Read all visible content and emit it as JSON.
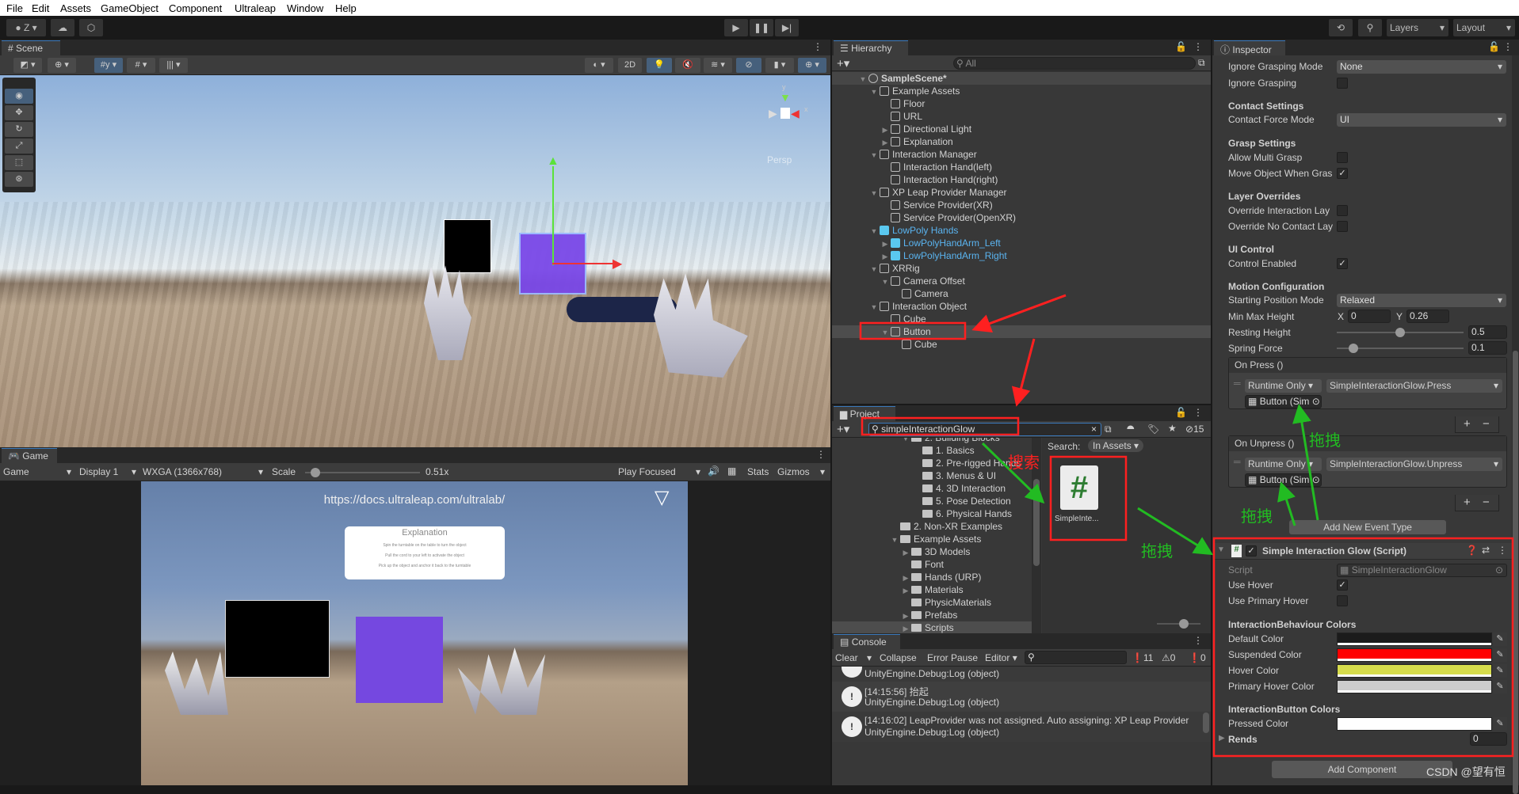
{
  "menu": [
    "File",
    "Edit",
    "Assets",
    "GameObject",
    "Component",
    "Ultraleap",
    "Window",
    "Help"
  ],
  "toolbar": {
    "account": "Z",
    "layers": "Layers",
    "layout": "Layout"
  },
  "colors": {
    "accent": "#3a79bb",
    "selection": "#4d4d4d",
    "prefab": "#5ac8ef",
    "annotation_red": "#ff2020",
    "annotation_green": "#22bb22",
    "suspended": "#ff0000",
    "hover": "#d6dc4c",
    "primary_hover": "#cccccc",
    "default": "#1b1b1b",
    "pressed": "#ffffff"
  },
  "scene": {
    "tab": "Scene",
    "two_d": "2D",
    "persp": "Persp",
    "gizmo_y": "y",
    "gizmo_x": "x"
  },
  "game": {
    "tab": "Game",
    "mode": "Game",
    "display": "Display 1",
    "resolution": "WXGA (1366x768)",
    "scale_label": "Scale",
    "scale_value": "0.51x",
    "scale_fraction": 0.05,
    "play_mode": "Play Focused",
    "stats": "Stats",
    "gizmos": "Gizmos",
    "url": "https://docs.ultraleap.com/ultralab/",
    "explanation": {
      "title": "Explanation",
      "lines": [
        "Spin the turntable on the table to turn the object",
        "Pull the cord to your left to activate the object",
        "Pick up the object and anchor it back to the turntable"
      ]
    }
  },
  "hierarchy": {
    "tab": "Hierarchy",
    "search_placeholder": "All",
    "items": [
      {
        "label": "SampleScene*",
        "level": 0,
        "expand": "open",
        "icon": "unity-scene",
        "scene": true
      },
      {
        "label": "Example Assets",
        "level": 1,
        "expand": "open",
        "icon": "cube"
      },
      {
        "label": "Floor",
        "level": 2,
        "expand": "",
        "icon": "cube"
      },
      {
        "label": "URL",
        "level": 2,
        "expand": "",
        "icon": "cube"
      },
      {
        "label": "Directional Light",
        "level": 2,
        "expand": "closed",
        "icon": "cube"
      },
      {
        "label": "Explanation",
        "level": 2,
        "expand": "closed",
        "icon": "cube"
      },
      {
        "label": "Interaction Manager",
        "level": 1,
        "expand": "open",
        "icon": "cube"
      },
      {
        "label": "Interaction Hand(left)",
        "level": 2,
        "expand": "",
        "icon": "cube"
      },
      {
        "label": "Interaction Hand(right)",
        "level": 2,
        "expand": "",
        "icon": "cube"
      },
      {
        "label": "XP Leap Provider Manager",
        "level": 1,
        "expand": "open",
        "icon": "cube"
      },
      {
        "label": "Service Provider(XR)",
        "level": 2,
        "expand": "",
        "icon": "cube"
      },
      {
        "label": "Service Provider(OpenXR)",
        "level": 2,
        "expand": "",
        "icon": "cube"
      },
      {
        "label": "LowPoly Hands",
        "level": 1,
        "expand": "open",
        "icon": "prefab",
        "prefab": true
      },
      {
        "label": "LowPolyHandArm_Left",
        "level": 2,
        "expand": "closed",
        "icon": "prefab",
        "prefab": true
      },
      {
        "label": "LowPolyHandArm_Right",
        "level": 2,
        "expand": "closed",
        "icon": "prefab",
        "prefab": true
      },
      {
        "label": "XRRig",
        "level": 1,
        "expand": "open",
        "icon": "cube"
      },
      {
        "label": "Camera Offset",
        "level": 2,
        "expand": "open",
        "icon": "cube"
      },
      {
        "label": "Camera",
        "level": 3,
        "expand": "",
        "icon": "cube"
      },
      {
        "label": "Interaction Object",
        "level": 1,
        "expand": "open",
        "icon": "cube"
      },
      {
        "label": "Cube",
        "level": 2,
        "expand": "",
        "icon": "cube"
      },
      {
        "label": "Button",
        "level": 2,
        "expand": "open",
        "icon": "cube",
        "selected": true
      },
      {
        "label": "Cube",
        "level": 3,
        "expand": "",
        "icon": "cube"
      }
    ]
  },
  "project": {
    "tab": "Project",
    "search_value": "simpleInteractionGlow",
    "hidden_count": "15",
    "search_label": "Search:",
    "search_scope": "In Assets",
    "tree": [
      {
        "label": "2. Building Blocks",
        "level": 1,
        "expand": "open"
      },
      {
        "label": "1. Basics",
        "level": 2,
        "expand": ""
      },
      {
        "label": "2. Pre-rigged Hands",
        "level": 2,
        "expand": ""
      },
      {
        "label": "3. Menus & UI",
        "level": 2,
        "expand": ""
      },
      {
        "label": "4. 3D Interaction",
        "level": 2,
        "expand": ""
      },
      {
        "label": "5. Pose Detection",
        "level": 2,
        "expand": ""
      },
      {
        "label": "6. Physical Hands",
        "level": 2,
        "expand": ""
      },
      {
        "label": "2. Non-XR Examples",
        "level": 0,
        "expand": ""
      },
      {
        "label": "Example Assets",
        "level": 0,
        "expand": "open"
      },
      {
        "label": "3D Models",
        "level": 1,
        "expand": "closed"
      },
      {
        "label": "Font",
        "level": 1,
        "expand": ""
      },
      {
        "label": "Hands (URP)",
        "level": 1,
        "expand": "closed"
      },
      {
        "label": "Materials",
        "level": 1,
        "expand": "closed"
      },
      {
        "label": "PhysicMaterials",
        "level": 1,
        "expand": ""
      },
      {
        "label": "Prefabs",
        "level": 1,
        "expand": "closed"
      },
      {
        "label": "Scripts",
        "level": 1,
        "expand": "closed",
        "selected": true
      }
    ],
    "asset": {
      "name": "SimpleInte...",
      "icon": "csharp-script"
    }
  },
  "console": {
    "tab": "Console",
    "clear": "Clear",
    "collapse": "Collapse",
    "error_pause": "Error Pause",
    "editor": "Editor",
    "log_count": "11",
    "warn_count": "0",
    "error_count": "0",
    "entries": [
      {
        "line1": "",
        "line2": "UnityEngine.Debug:Log (object)"
      },
      {
        "line1": "[14:15:56] 抬起",
        "line2": "UnityEngine.Debug:Log (object)"
      },
      {
        "line1": "[14:16:02] LeapProvider was not assigned. Auto assigning: XP Leap Provider",
        "line2": "UnityEngine.Debug:Log (object)"
      }
    ]
  },
  "inspector": {
    "tab": "Inspector",
    "ignore_grasping_mode": {
      "label": "Ignore Grasping Mode",
      "value": "None"
    },
    "ignore_grasping": {
      "label": "Ignore Grasping",
      "checked": false
    },
    "contact_settings": "Contact Settings",
    "contact_force_mode": {
      "label": "Contact Force Mode",
      "value": "UI"
    },
    "grasp_settings": "Grasp Settings",
    "allow_multi_grasp": {
      "label": "Allow Multi Grasp",
      "checked": false
    },
    "move_object": {
      "label": "Move Object When Gras",
      "checked": true
    },
    "layer_overrides": "Layer Overrides",
    "override_interaction": {
      "label": "Override Interaction Lay",
      "checked": false
    },
    "override_no_contact": {
      "label": "Override No Contact Lay",
      "checked": false
    },
    "ui_control": "UI Control",
    "control_enabled": {
      "label": "Control Enabled",
      "checked": true
    },
    "motion_config": "Motion Configuration",
    "starting_position": {
      "label": "Starting Position Mode",
      "value": "Relaxed"
    },
    "min_max": {
      "label": "Min Max Height",
      "x_label": "X",
      "x": "0",
      "y_label": "Y",
      "y": "0.26"
    },
    "resting_height": {
      "label": "Resting Height",
      "value": "0.5",
      "fraction": 0.5
    },
    "spring_force": {
      "label": "Spring Force",
      "value": "0.1",
      "fraction": 0.1
    },
    "on_press": {
      "header": "On Press ()",
      "mode": "Runtime Only",
      "function": "SimpleInteractionGlow.Press",
      "target": "Button (Sim"
    },
    "on_unpress": {
      "header": "On Unpress ()",
      "mode": "Runtime Only",
      "function": "SimpleInteractionGlow.Unpress",
      "target": "Button (Sim"
    },
    "plus": "+",
    "minus": "−",
    "add_event": "Add New Event Type",
    "component": {
      "title": "Simple Interaction Glow (Script)",
      "enabled": true,
      "script": {
        "label": "Script",
        "value": "SimpleInteractionGlow"
      },
      "use_hover": {
        "label": "Use Hover",
        "checked": true
      },
      "use_primary_hover": {
        "label": "Use Primary Hover",
        "checked": false
      },
      "ib_colors": "InteractionBehaviour Colors",
      "default_color": "Default Color",
      "suspended_color": "Suspended Color",
      "hover_color": "Hover Color",
      "primary_hover_color": "Primary Hover Color",
      "ibutton_colors": "InteractionButton Colors",
      "pressed_color": "Pressed Color",
      "rends": {
        "label": "Rends",
        "value": "0"
      }
    },
    "add_component": "Add Component"
  },
  "annotations": {
    "search": "搜索",
    "drag1": "拖拽",
    "drag2": "拖拽",
    "drag3": "拖拽",
    "watermark": "CSDN @望有恒"
  }
}
